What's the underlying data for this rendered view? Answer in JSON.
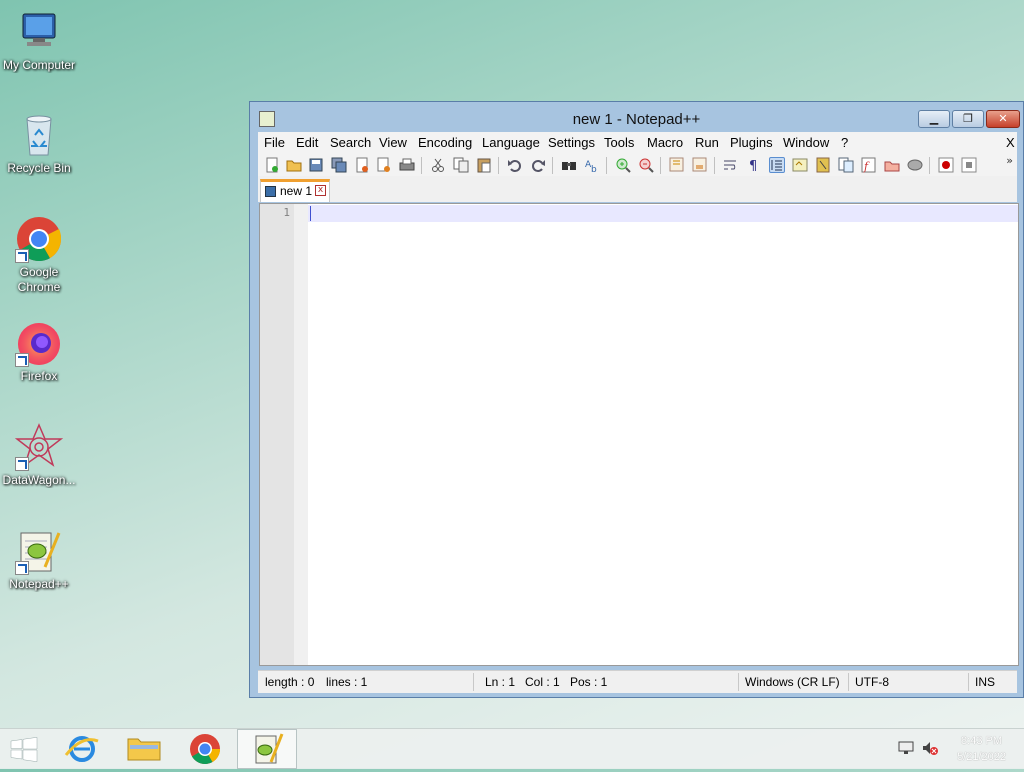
{
  "desktop": {
    "icons": [
      {
        "label": "My Computer",
        "icon": "computer-icon"
      },
      {
        "label": "Recycle Bin",
        "icon": "recycle-bin-icon"
      },
      {
        "label": "Google\nChrome",
        "icon": "chrome-icon"
      },
      {
        "label": "Firefox",
        "icon": "firefox-icon"
      },
      {
        "label": "DataWagon...",
        "icon": "datawagon-icon"
      },
      {
        "label": "Notepad++",
        "icon": "notepadpp-icon"
      }
    ]
  },
  "window": {
    "title": "new 1 - Notepad++",
    "controls": {
      "minimize": "▁",
      "maximize": "❐",
      "close": "✕"
    },
    "menu": [
      "File",
      "Edit",
      "Search",
      "View",
      "Encoding",
      "Language",
      "Settings",
      "Tools",
      "Macro",
      "Run",
      "Plugins",
      "Window",
      "?"
    ],
    "menu_close": "X",
    "toolbar_more": "»",
    "tabs": [
      {
        "name": "new 1",
        "close": "x"
      }
    ],
    "editor": {
      "line_numbers": [
        "1"
      ],
      "content": ""
    },
    "status": {
      "length": "length : 0",
      "lines": "lines : 1",
      "ln": "Ln : 1",
      "col": "Col : 1",
      "pos": "Pos : 1",
      "eol": "Windows (CR LF)",
      "encoding": "UTF-8",
      "mode": "INS"
    }
  },
  "taskbar": {
    "apps": [
      "start-button",
      "internet-explorer",
      "file-explorer",
      "chrome",
      "notepadpp"
    ],
    "active_app": "notepadpp",
    "clock": {
      "time": "8:43 PM",
      "date": "5/21/2022"
    }
  },
  "colors": {
    "accent_tab": "#f0a030",
    "title_bar": "#a7c4e0",
    "close_button": "#c6402a"
  }
}
